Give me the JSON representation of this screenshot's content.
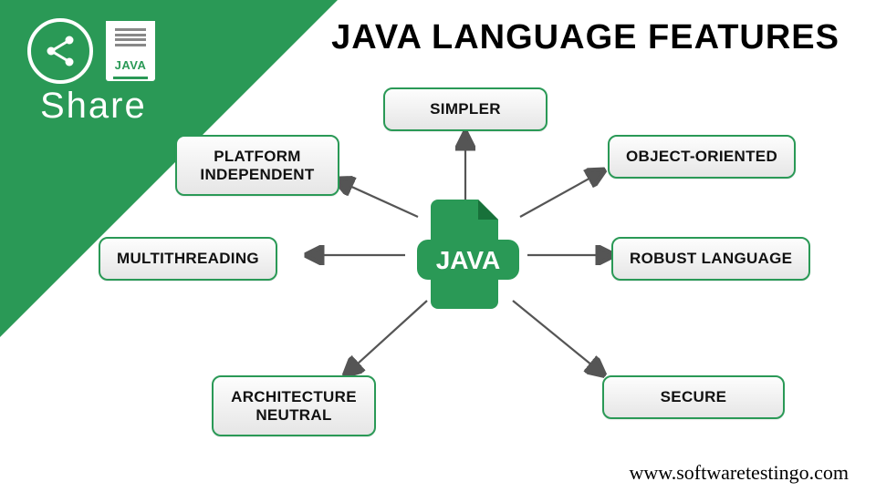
{
  "title": "JAVA LANGUAGE FEATURES",
  "share": {
    "label": "Share",
    "doc_label": "JAVA"
  },
  "center": {
    "label": "JAVA"
  },
  "features": {
    "simpler": "SIMPLER",
    "platform_independent": "PLATFORM\nINDEPENDENT",
    "object_oriented": "OBJECT-ORIENTED",
    "multithreading": "MULTITHREADING",
    "robust": "ROBUST LANGUAGE",
    "architecture_neutral": "ARCHITECTURE\nNEUTRAL",
    "secure": "SECURE"
  },
  "url": "www.softwaretestingo.com",
  "colors": {
    "brand": "#2a9956"
  }
}
